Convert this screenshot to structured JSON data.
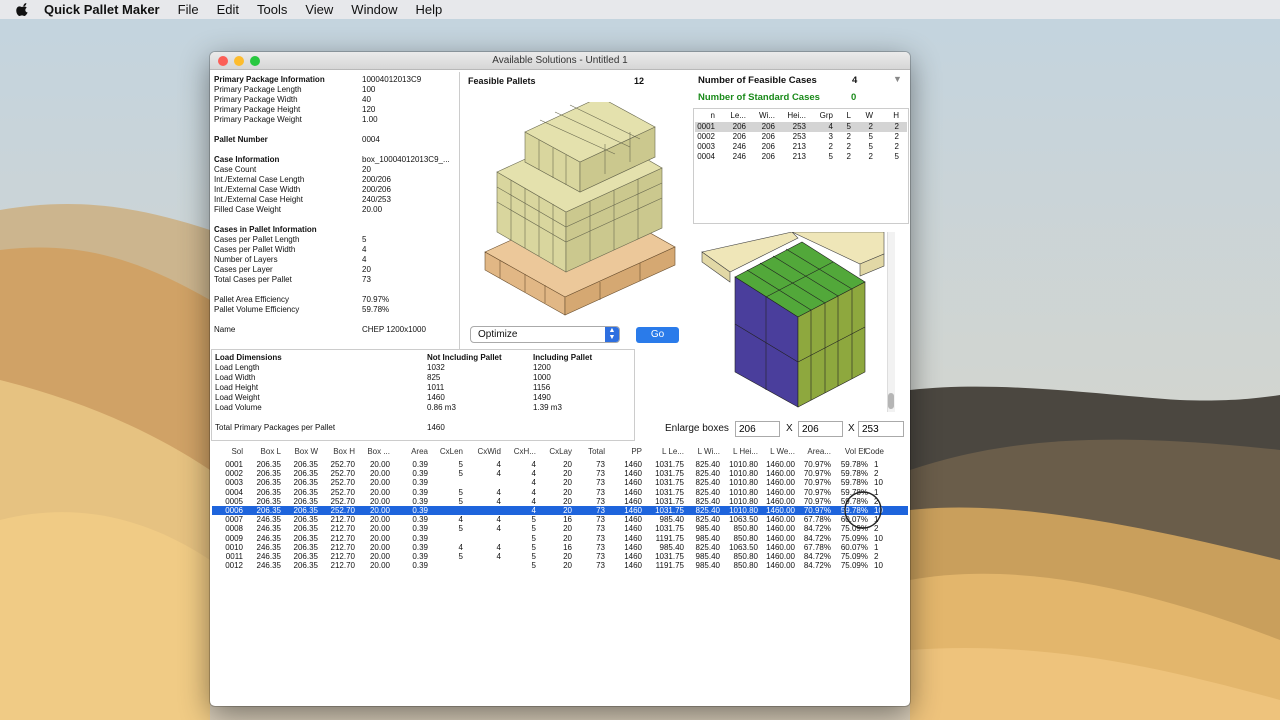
{
  "menubar": {
    "apple_icon": "apple-logo",
    "app_name": "Quick Pallet Maker",
    "items": [
      "File",
      "Edit",
      "Tools",
      "View",
      "Window",
      "Help"
    ]
  },
  "window": {
    "title": "Available Solutions - Untitled 1"
  },
  "info": {
    "rows": [
      {
        "label": "Primary Package Information",
        "value": "10004012013C9",
        "bold": true
      },
      {
        "label": "Primary Package Length",
        "value": "100"
      },
      {
        "label": "Primary Package Width",
        "value": "40"
      },
      {
        "label": "Primary Package Height",
        "value": "120"
      },
      {
        "label": "Primary Package Weight",
        "value": "1.00"
      },
      {
        "label": "",
        "value": ""
      },
      {
        "label": "Pallet Number",
        "value": "0004",
        "bold": true
      },
      {
        "label": "",
        "value": ""
      },
      {
        "label": "Case Information",
        "value": "box_10004012013C9_...",
        "bold": true
      },
      {
        "label": "Case Count",
        "value": "20"
      },
      {
        "label": "Int./External Case Length",
        "value": "200/206"
      },
      {
        "label": "Int./External Case Width",
        "value": "200/206"
      },
      {
        "label": "Int./External Case Height",
        "value": "240/253"
      },
      {
        "label": "Filled Case Weight",
        "value": "20.00"
      },
      {
        "label": "",
        "value": ""
      },
      {
        "label": "Cases in Pallet Information",
        "value": "",
        "bold": true
      },
      {
        "label": "Cases per Pallet Length",
        "value": "5"
      },
      {
        "label": "Cases per Pallet Width",
        "value": "4"
      },
      {
        "label": "Number of Layers",
        "value": "4"
      },
      {
        "label": "Cases per Layer",
        "value": "20"
      },
      {
        "label": "Total Cases per Pallet",
        "value": "73"
      },
      {
        "label": "",
        "value": ""
      },
      {
        "label": "Pallet Area Efficiency",
        "value": "70.97%"
      },
      {
        "label": "Pallet Volume Efficiency",
        "value": "59.78%"
      },
      {
        "label": "",
        "value": ""
      },
      {
        "label": "Name",
        "value": "CHEP 1200x1000"
      }
    ]
  },
  "load": {
    "headers": [
      "Load Dimensions",
      "Not Including Pallet",
      "Including Pallet"
    ],
    "rows": [
      [
        "Load Length",
        "1032",
        "1200"
      ],
      [
        "Load Width",
        "825",
        "1000"
      ],
      [
        "Load Height",
        "1011",
        "1156"
      ],
      [
        "Load Weight",
        "1460",
        "1490"
      ],
      [
        "Load Volume",
        "0.86 m3",
        "1.39 m3"
      ]
    ],
    "total_label": "Total Primary Packages per Pallet",
    "total_value": "1460"
  },
  "feasible": {
    "label": "Feasible Pallets",
    "count": "12"
  },
  "cases_info": {
    "feasible_label": "Number of Feasible Cases",
    "feasible_count": "4",
    "standard_label": "Number of Standard Cases",
    "standard_count": "0",
    "standard_color": "#1a8a1a",
    "headers": [
      "n",
      "Le...",
      "Wi...",
      "Hei...",
      "Grp",
      "L",
      "W",
      "H"
    ],
    "rows": [
      [
        "0001",
        "206",
        "206",
        "253",
        "4",
        "5",
        "2",
        "2"
      ],
      [
        "0002",
        "206",
        "206",
        "253",
        "3",
        "2",
        "5",
        "2"
      ],
      [
        "0003",
        "246",
        "206",
        "213",
        "2",
        "2",
        "5",
        "2"
      ],
      [
        "0004",
        "246",
        "206",
        "213",
        "5",
        "2",
        "2",
        "5"
      ]
    ],
    "selected_row": 0
  },
  "optimize": {
    "select_value": "Optimize",
    "go_label": "Go"
  },
  "enlarge": {
    "label": "Enlarge boxes",
    "x": "206",
    "y": "206",
    "z": "253",
    "sep": "X"
  },
  "solutions": {
    "headers": [
      "Sol",
      "Box L",
      "Box W",
      "Box H",
      "Box ...",
      "Area",
      "CxLen",
      "CxWid",
      "CxH...",
      "CxLay",
      "Total",
      "PP",
      "L Le...",
      "L Wi...",
      "L Hei...",
      "L We...",
      "Area...",
      "Vol Ef.",
      "Code"
    ],
    "rows": [
      [
        "0001",
        "206.35",
        "206.35",
        "252.70",
        "20.00",
        "0.39",
        "5",
        "4",
        "4",
        "20",
        "73",
        "1460",
        "1031.75",
        "825.40",
        "1010.80",
        "1460.00",
        "70.97%",
        "59.78%",
        "1"
      ],
      [
        "0002",
        "206.35",
        "206.35",
        "252.70",
        "20.00",
        "0.39",
        "5",
        "4",
        "4",
        "20",
        "73",
        "1460",
        "1031.75",
        "825.40",
        "1010.80",
        "1460.00",
        "70.97%",
        "59.78%",
        "2"
      ],
      [
        "0003",
        "206.35",
        "206.35",
        "252.70",
        "20.00",
        "0.39",
        "",
        "",
        "4",
        "20",
        "73",
        "1460",
        "1031.75",
        "825.40",
        "1010.80",
        "1460.00",
        "70.97%",
        "59.78%",
        "10"
      ],
      [
        "0004",
        "206.35",
        "206.35",
        "252.70",
        "20.00",
        "0.39",
        "5",
        "4",
        "4",
        "20",
        "73",
        "1460",
        "1031.75",
        "825.40",
        "1010.80",
        "1460.00",
        "70.97%",
        "59.78%",
        "1"
      ],
      [
        "0005",
        "206.35",
        "206.35",
        "252.70",
        "20.00",
        "0.39",
        "5",
        "4",
        "4",
        "20",
        "73",
        "1460",
        "1031.75",
        "825.40",
        "1010.80",
        "1460.00",
        "70.97%",
        "59.78%",
        "2"
      ],
      [
        "0006",
        "206.35",
        "206.35",
        "252.70",
        "20.00",
        "0.39",
        "",
        "",
        "4",
        "20",
        "73",
        "1460",
        "1031.75",
        "825.40",
        "1010.80",
        "1460.00",
        "70.97%",
        "59.78%",
        "10"
      ],
      [
        "0007",
        "246.35",
        "206.35",
        "212.70",
        "20.00",
        "0.39",
        "4",
        "4",
        "5",
        "16",
        "73",
        "1460",
        "985.40",
        "825.40",
        "1063.50",
        "1460.00",
        "67.78%",
        "60.07%",
        "1"
      ],
      [
        "0008",
        "246.35",
        "206.35",
        "212.70",
        "20.00",
        "0.39",
        "5",
        "4",
        "5",
        "20",
        "73",
        "1460",
        "1031.75",
        "985.40",
        "850.80",
        "1460.00",
        "84.72%",
        "75.09%",
        "2"
      ],
      [
        "0009",
        "246.35",
        "206.35",
        "212.70",
        "20.00",
        "0.39",
        "",
        "",
        "5",
        "20",
        "73",
        "1460",
        "1191.75",
        "985.40",
        "850.80",
        "1460.00",
        "84.72%",
        "75.09%",
        "10"
      ],
      [
        "0010",
        "246.35",
        "206.35",
        "212.70",
        "20.00",
        "0.39",
        "4",
        "4",
        "5",
        "16",
        "73",
        "1460",
        "985.40",
        "825.40",
        "1063.50",
        "1460.00",
        "67.78%",
        "60.07%",
        "1"
      ],
      [
        "0011",
        "246.35",
        "206.35",
        "212.70",
        "20.00",
        "0.39",
        "5",
        "4",
        "5",
        "20",
        "73",
        "1460",
        "1031.75",
        "985.40",
        "850.80",
        "1460.00",
        "84.72%",
        "75.09%",
        "2"
      ],
      [
        "0012",
        "246.35",
        "206.35",
        "212.70",
        "20.00",
        "0.39",
        "",
        "",
        "5",
        "20",
        "73",
        "1460",
        "1191.75",
        "985.40",
        "850.80",
        "1460.00",
        "84.72%",
        "75.09%",
        "10"
      ]
    ],
    "selected_row": 5,
    "selected_color": "#1e64dc"
  },
  "colors": {
    "box_fill": "#dcd9a2",
    "pallet_wood": "#ecc89a",
    "case_green": "#52a83a",
    "case_purple": "#4a3e9c",
    "case_olive": "#8ea83e",
    "close": "#fc5f57",
    "minimize": "#fdbc2e",
    "zoom": "#28c840"
  }
}
